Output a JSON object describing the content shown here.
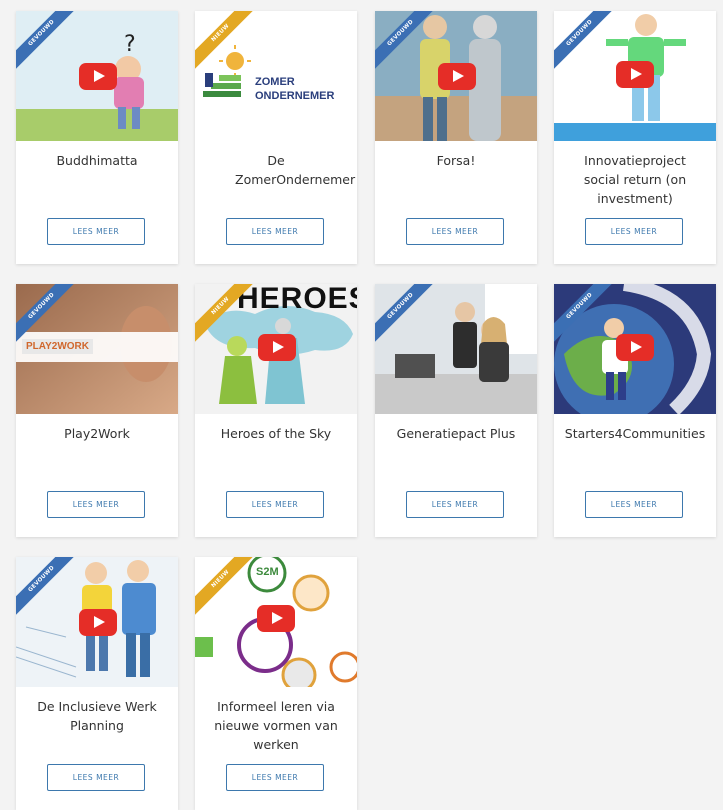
{
  "colors": {
    "ribbon_blue": "#3b6fb4",
    "ribbon_gold": "#e3a823",
    "button_border": "#3d78ad",
    "youtube_red": "#e52d27"
  },
  "cards": [
    {
      "title": "Buddhimatta",
      "button": "LEES MEER",
      "ribbon": "GEVOUWD",
      "ribbon_color": "blue",
      "video": true
    },
    {
      "title": "De ZomerOndernemer",
      "button": "LEES MEER",
      "ribbon": "NIEUW",
      "ribbon_color": "gold",
      "video": false,
      "logo_text_1": "ZOMER",
      "logo_text_2": "ONDERNEMER"
    },
    {
      "title": "Forsa!",
      "button": "LEES MEER",
      "ribbon": "GEVOUWD",
      "ribbon_color": "blue",
      "video": true
    },
    {
      "title": "Innovatieproject social return (on investment)",
      "button": "LEES MEER",
      "ribbon": "GEVOUWD",
      "ribbon_color": "blue",
      "video": true
    },
    {
      "title": "Play2Work",
      "button": "LEES MEER",
      "ribbon": "GEVOUWD",
      "ribbon_color": "blue",
      "video": false,
      "logo_text": "PLAY2WORK"
    },
    {
      "title": "Heroes of the Sky",
      "button": "LEES MEER",
      "ribbon": "NIEUW",
      "ribbon_color": "gold",
      "video": true,
      "art_text": "HEROES"
    },
    {
      "title": "Generatiepact Plus",
      "button": "LEES MEER",
      "ribbon": "GEVOUWD",
      "ribbon_color": "blue",
      "video": false
    },
    {
      "title": "Starters4Communities",
      "button": "LEES MEER",
      "ribbon": "GEVOUWD",
      "ribbon_color": "blue",
      "video": true
    },
    {
      "title": "De Inclusieve Werk Planning",
      "button": "LEES MEER",
      "ribbon": "GEVOUWD",
      "ribbon_color": "blue",
      "video": true
    },
    {
      "title": "Informeel leren via nieuwe vormen van werken",
      "button": "LEES MEER",
      "ribbon": "NIEUW",
      "ribbon_color": "gold",
      "video": true,
      "art_text": "S2M"
    }
  ]
}
